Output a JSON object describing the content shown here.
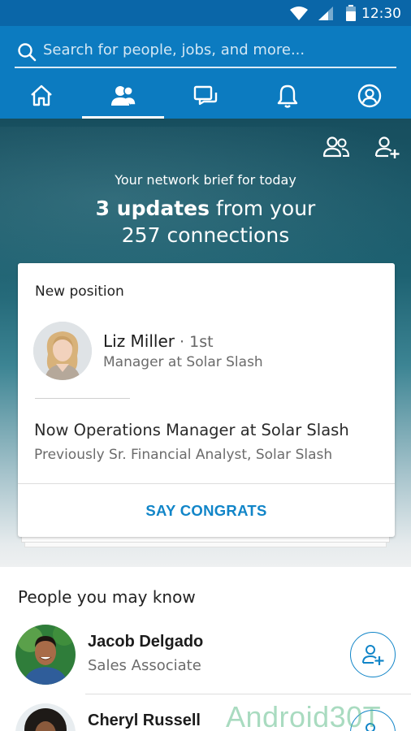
{
  "status_bar": {
    "time": "12:30"
  },
  "search": {
    "placeholder": "Search for people, jobs, and more..."
  },
  "tabs": [
    {
      "name": "home",
      "icon": "home-icon"
    },
    {
      "name": "my-network",
      "icon": "people-icon",
      "active": true
    },
    {
      "name": "messaging",
      "icon": "messages-icon"
    },
    {
      "name": "notifications",
      "icon": "bell-icon"
    },
    {
      "name": "me",
      "icon": "profile-icon"
    }
  ],
  "hero": {
    "brief": "Your network brief for today",
    "updates_bold": "3 updates",
    "updates_rest": " from your",
    "connections": "257 connections"
  },
  "card": {
    "heading": "New position",
    "person_name": "Liz Miller",
    "separator": " · ",
    "degree": "1st",
    "role": "Manager at Solar Slash",
    "now": "Now Operations Manager at Solar Slash",
    "previous": "Previously Sr. Financial Analyst, Solar Slash",
    "action": "SAY CONGRATS"
  },
  "pymk": {
    "title": "People you may know",
    "people": [
      {
        "name": "Jacob Delgado",
        "role": "Sales Associate"
      },
      {
        "name": "Cheryl Russell",
        "role": ""
      }
    ]
  },
  "watermark": "Android30T",
  "colors": {
    "accent": "#0c7bc0",
    "status_bar": "#0a66a8",
    "link": "#1185c8"
  }
}
